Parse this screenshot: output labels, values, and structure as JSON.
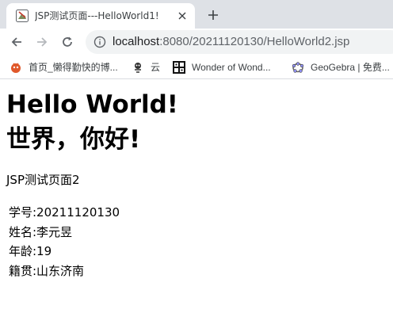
{
  "browser": {
    "tab": {
      "title": "JSP测试页面---HelloWorld1!"
    },
    "address": {
      "host": "localhost",
      "path": ":8080/20211120130/HelloWorld2.jsp"
    },
    "bookmarks": [
      {
        "label": "首页_懒得勤快的博...",
        "icon": "csdn-icon"
      },
      {
        "label": "云",
        "icon": "cloud-mascot-icon"
      },
      {
        "label": "Wonder of Wond...",
        "icon": "wonder-grid-icon"
      },
      {
        "label": "GeoGebra | 免费...",
        "icon": "geogebra-icon"
      }
    ]
  },
  "page": {
    "heading_en": "Hello World!",
    "heading_cn": "世界，你好!",
    "subtitle": "JSP测试页面2",
    "info": [
      "学号:20211120130",
      "姓名:李元昱",
      "年龄:19",
      "籍贯:山东济南"
    ]
  }
}
